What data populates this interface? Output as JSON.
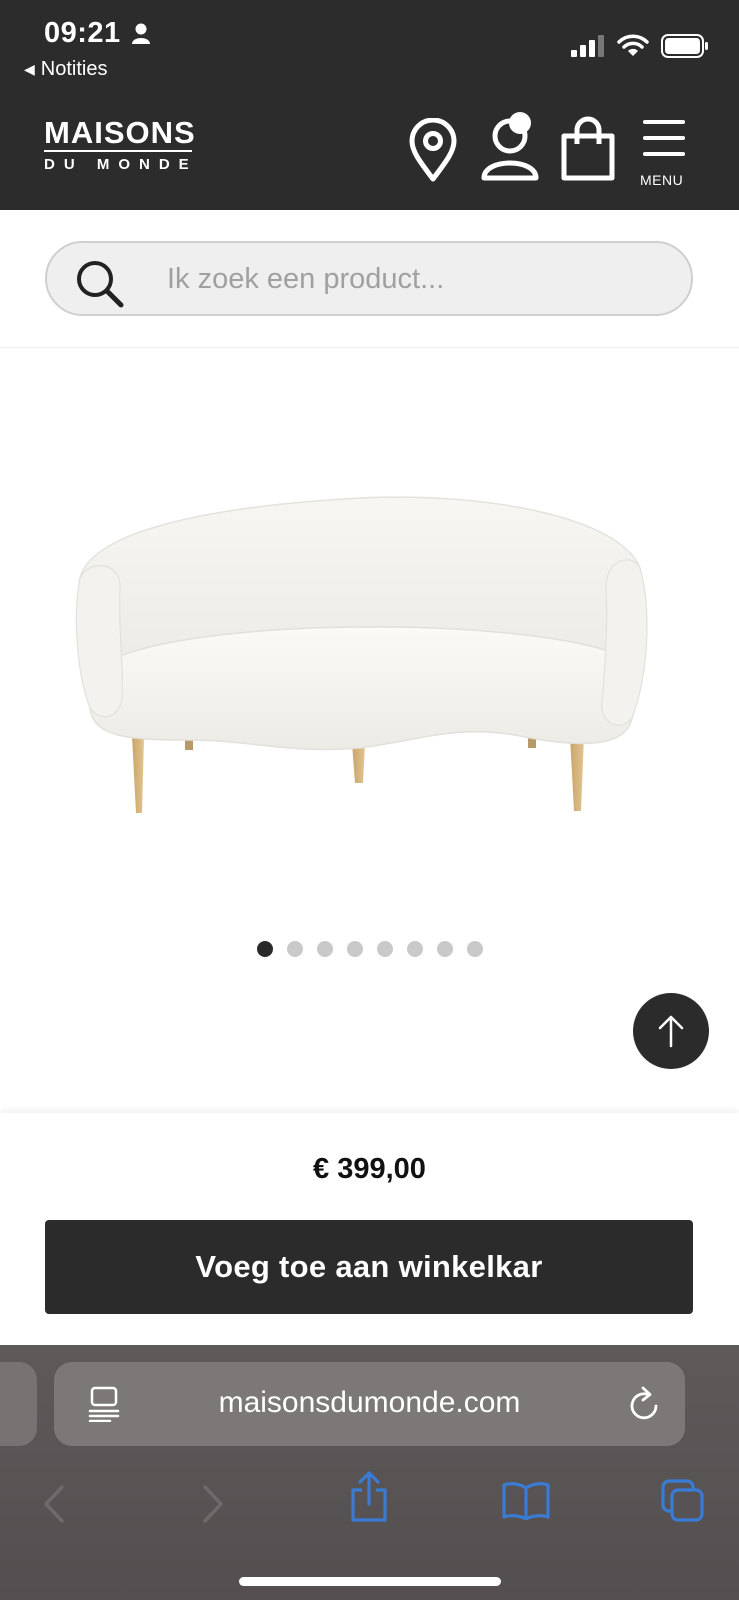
{
  "status_bar": {
    "time": "09:21",
    "back_label": "Notities",
    "icons": [
      "person-icon",
      "signal-icon",
      "wifi-icon",
      "battery-icon"
    ]
  },
  "header": {
    "logo_line1": "MAISONS",
    "logo_line2": "DU MONDE",
    "menu_label": "MENU",
    "icons": [
      "location-pin-icon",
      "account-icon",
      "shopping-bag-icon",
      "hamburger-menu-icon"
    ],
    "background_color": "#2c2c2c"
  },
  "search": {
    "placeholder": "Ik zoek een product..."
  },
  "product": {
    "image": "sofa-image",
    "carousel": {
      "total": 8,
      "active_index": 0
    }
  },
  "purchase": {
    "price": "€ 399,00",
    "add_to_cart_label": "Voeg toe aan winkelkar"
  },
  "browser": {
    "url": "maisonsdumonde.com",
    "icons": [
      "reader-icon",
      "reload-icon",
      "back-arrow-icon",
      "forward-arrow-icon",
      "share-icon",
      "bookmarks-icon",
      "tabs-icon"
    ],
    "accent_color": "#3a7bd5"
  }
}
